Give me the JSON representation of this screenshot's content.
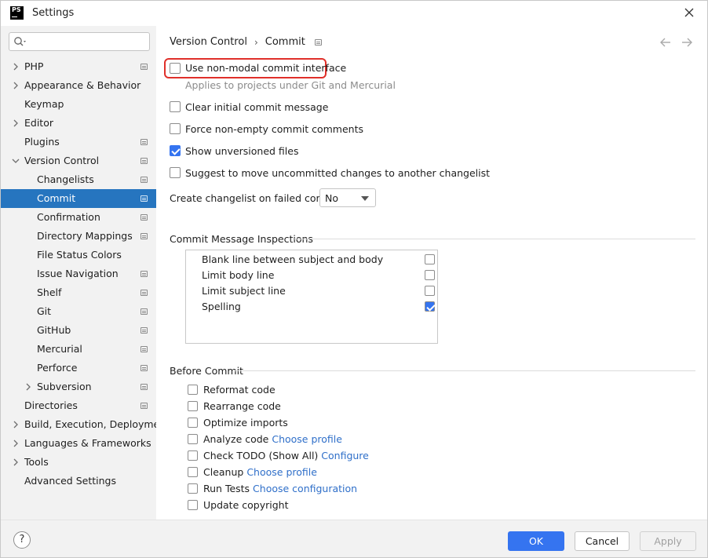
{
  "window": {
    "title": "Settings",
    "app_icon_text": "PS"
  },
  "sidebar": {
    "search_placeholder": "",
    "items": [
      {
        "label": "PHP",
        "expandable": true,
        "expanded": false,
        "project": true,
        "indent": 0
      },
      {
        "label": "Appearance & Behavior",
        "expandable": true,
        "expanded": false,
        "project": false,
        "indent": 0
      },
      {
        "label": "Keymap",
        "expandable": false,
        "project": false,
        "indent": 0
      },
      {
        "label": "Editor",
        "expandable": true,
        "expanded": false,
        "project": false,
        "indent": 0
      },
      {
        "label": "Plugins",
        "expandable": false,
        "project": true,
        "indent": 0
      },
      {
        "label": "Version Control",
        "expandable": true,
        "expanded": true,
        "project": true,
        "indent": 0
      },
      {
        "label": "Changelists",
        "expandable": false,
        "project": true,
        "indent": 1
      },
      {
        "label": "Commit",
        "expandable": false,
        "project": true,
        "indent": 1,
        "selected": true
      },
      {
        "label": "Confirmation",
        "expandable": false,
        "project": true,
        "indent": 1
      },
      {
        "label": "Directory Mappings",
        "expandable": false,
        "project": true,
        "indent": 1
      },
      {
        "label": "File Status Colors",
        "expandable": false,
        "project": false,
        "indent": 1
      },
      {
        "label": "Issue Navigation",
        "expandable": false,
        "project": true,
        "indent": 1
      },
      {
        "label": "Shelf",
        "expandable": false,
        "project": true,
        "indent": 1
      },
      {
        "label": "Git",
        "expandable": false,
        "project": true,
        "indent": 1
      },
      {
        "label": "GitHub",
        "expandable": false,
        "project": true,
        "indent": 1
      },
      {
        "label": "Mercurial",
        "expandable": false,
        "project": true,
        "indent": 1
      },
      {
        "label": "Perforce",
        "expandable": false,
        "project": true,
        "indent": 1
      },
      {
        "label": "Subversion",
        "expandable": true,
        "expanded": false,
        "project": true,
        "indent": 1
      },
      {
        "label": "Directories",
        "expandable": false,
        "project": true,
        "indent": 0
      },
      {
        "label": "Build, Execution, Deployment",
        "expandable": true,
        "expanded": false,
        "project": false,
        "indent": 0
      },
      {
        "label": "Languages & Frameworks",
        "expandable": true,
        "expanded": false,
        "project": false,
        "indent": 0
      },
      {
        "label": "Tools",
        "expandable": true,
        "expanded": false,
        "project": false,
        "indent": 0
      },
      {
        "label": "Advanced Settings",
        "expandable": false,
        "project": false,
        "indent": 0
      }
    ]
  },
  "breadcrumb": {
    "parent": "Version Control",
    "separator": "›",
    "current": "Commit"
  },
  "nav": {
    "back_icon": "arrow-left-icon",
    "forward_icon": "arrow-right-icon"
  },
  "options": {
    "non_modal": {
      "label": "Use non-modal commit interface",
      "checked": false
    },
    "non_modal_hint": "Applies to projects under Git and Mercurial",
    "clear_initial": {
      "label": "Clear initial commit message",
      "checked": false
    },
    "force_nonempty": {
      "label": "Force non-empty commit comments",
      "checked": false
    },
    "show_unversioned": {
      "label": "Show unversioned files",
      "checked": true
    },
    "suggest_move": {
      "label": "Suggest to move uncommitted changes to another changelist",
      "checked": false
    }
  },
  "changelist": {
    "label": "Create changelist on failed commit:",
    "value": "No"
  },
  "inspections": {
    "title": "Commit Message Inspections",
    "items": [
      {
        "label": "Blank line between subject and body",
        "checked": false
      },
      {
        "label": "Limit body line",
        "checked": false
      },
      {
        "label": "Limit subject line",
        "checked": false
      },
      {
        "label": "Spelling",
        "checked": true
      }
    ]
  },
  "before_commit": {
    "title": "Before Commit",
    "items": [
      {
        "label": "Reformat code",
        "link": "",
        "checked": false
      },
      {
        "label": "Rearrange code",
        "link": "",
        "checked": false
      },
      {
        "label": "Optimize imports",
        "link": "",
        "checked": false
      },
      {
        "label": "Analyze code",
        "link": "Choose profile",
        "checked": false
      },
      {
        "label": "Check TODO (Show All)",
        "link": "Configure",
        "checked": false
      },
      {
        "label": "Cleanup",
        "link": "Choose profile",
        "checked": false
      },
      {
        "label": "Run Tests",
        "link": "Choose configuration",
        "checked": false
      },
      {
        "label": "Update copyright",
        "link": "",
        "checked": false
      }
    ]
  },
  "footer": {
    "help": "?",
    "ok": "OK",
    "cancel": "Cancel",
    "apply": "Apply"
  },
  "colors": {
    "accent": "#3574f0",
    "selection": "#2675bf",
    "highlight_border": "#e0302a",
    "link": "#2f6fc9"
  }
}
